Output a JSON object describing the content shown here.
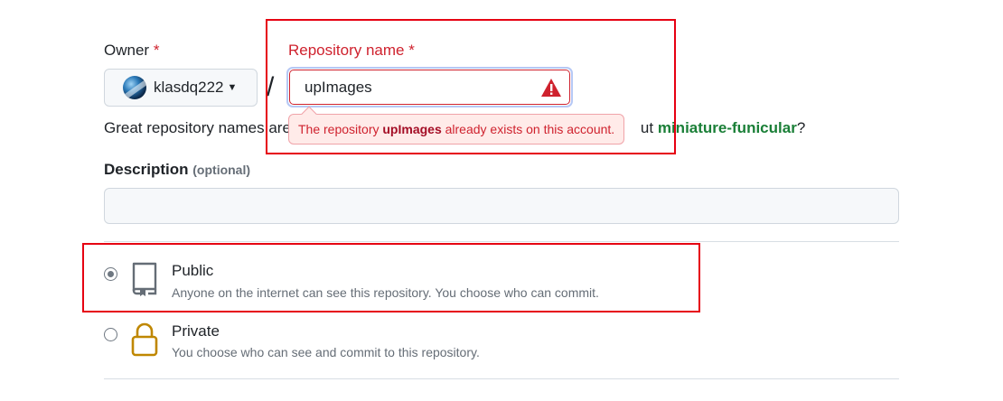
{
  "owner": {
    "label": "Owner",
    "required_mark": "*",
    "selected": "klasdq222"
  },
  "separator": "/",
  "repository": {
    "label": "Repository name",
    "required_mark": "*",
    "value": "upImages",
    "error": {
      "prefix": "The repository",
      "name": "upImages",
      "suffix": "already exists on this account."
    }
  },
  "hint": {
    "before": "Great repository names are",
    "after": "ut",
    "suggestion": "miniature-funicular",
    "end": "?"
  },
  "description": {
    "label": "Description",
    "optional": "(optional)",
    "value": ""
  },
  "visibility": {
    "options": [
      {
        "title": "Public",
        "desc": "Anyone on the internet can see this repository. You choose who can commit.",
        "checked": true,
        "icon": "repo-icon"
      },
      {
        "title": "Private",
        "desc": "You choose who can see and commit to this repository.",
        "checked": false,
        "icon": "lock-icon"
      }
    ]
  },
  "colors": {
    "required": "#cf222e",
    "suggestion": "#1a7f37",
    "lock": "#bf8700",
    "highlight_box": "#e60012"
  }
}
